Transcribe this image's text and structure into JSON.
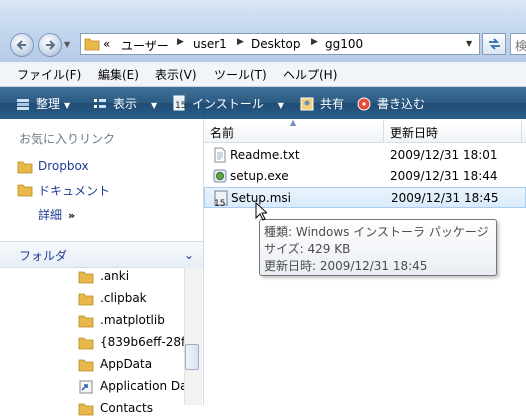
{
  "address": {
    "back_icon": "back-arrow-icon",
    "forward_icon": "forward-arrow-icon",
    "overflow": "«",
    "crumbs": [
      "ユーザー",
      "user1",
      "Desktop",
      "gg100"
    ],
    "search_placeholder": "検"
  },
  "menu": [
    "ファイル(F)",
    "編集(E)",
    "表示(V)",
    "ツール(T)",
    "ヘルプ(H)"
  ],
  "commands": {
    "organize": "整理",
    "views": "表示",
    "install": "インストール",
    "share": "共有",
    "burn": "書き込む"
  },
  "favorites": {
    "title": "お気に入りリンク",
    "items": [
      "Dropbox",
      "ドキュメント"
    ],
    "more": "詳細"
  },
  "folders": {
    "title": "フォルダ",
    "items": [
      ".anki",
      ".clipbak",
      ".matplotlib",
      "{839b6eff-28f:",
      "AppData",
      "Application Da",
      "Contacts"
    ]
  },
  "columns": {
    "name": "名前",
    "date": "更新日時"
  },
  "files": [
    {
      "name": "Readme.txt",
      "date": "2009/12/31 18:01"
    },
    {
      "name": "setup.exe",
      "date": "2009/12/31 18:44"
    },
    {
      "name": "Setup.msi",
      "date": "2009/12/31 18:45"
    }
  ],
  "tooltip": {
    "type": "種類: Windows インストーラ パッケージ",
    "size": "サイズ: 429 KB",
    "modified": "更新日時: 2009/12/31 18:45"
  },
  "colors": {
    "selection": "#d9ebfb",
    "link": "#1f3c94",
    "commandbar": "#2b5a82"
  }
}
